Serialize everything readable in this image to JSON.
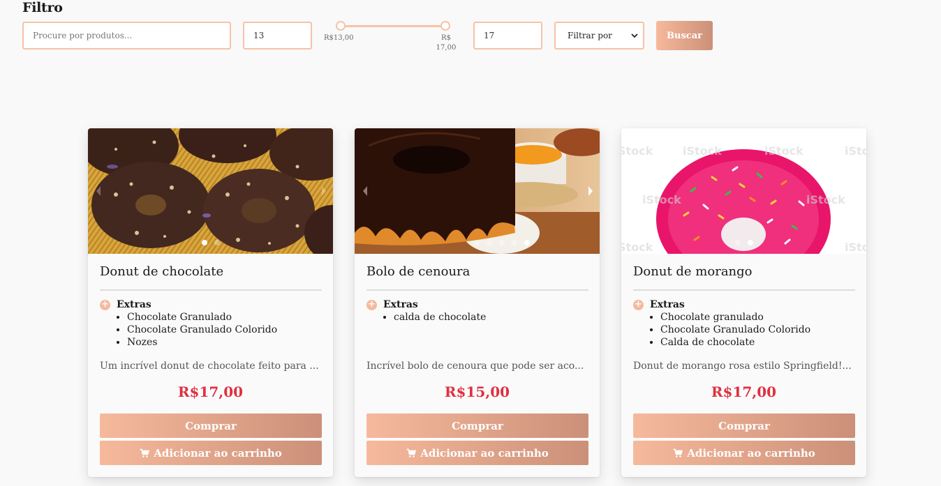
{
  "filter": {
    "title": "Filtro",
    "search_placeholder": "Procure por produtos...",
    "min_value": "13",
    "max_value": "17",
    "range_min_label": "R$13,00",
    "range_max_label": "R$ 17,00",
    "range_min": 13,
    "range_max": 17,
    "sort_selected": "Filtrar por",
    "search_button": "Buscar"
  },
  "colors": {
    "accent": "#f6b99c",
    "accent_dark": "#cb9079",
    "price": "#e03040",
    "border": "#f6c3a7"
  },
  "products": [
    {
      "name": "Donut de chocolate",
      "extras_title": "Extras",
      "extras": [
        "Chocolate Granulado",
        "Chocolate Granulado Colorido",
        "Nozes"
      ],
      "description": "Um incrível donut de chocolate feito para ...",
      "price": "R$17,00",
      "buy_label": "Comprar",
      "cart_label": "Adicionar ao carrinho",
      "images": 2,
      "active_image": 1
    },
    {
      "name": "Bolo de cenoura",
      "extras_title": "Extras",
      "extras": [
        "calda de chocolate"
      ],
      "description": "Incrível bolo de cenoura que pode ser aco...",
      "price": "R$15,00",
      "buy_label": "Comprar",
      "cart_label": "Adicionar ao carrinho",
      "images": 5,
      "active_image": 5
    },
    {
      "name": "Donut de morango",
      "extras_title": "Extras",
      "extras": [
        "Chocolate granulado",
        "Chocolate Granulado Colorido",
        "Calda de chocolate"
      ],
      "description": "Donut de morango rosa estilo Springfield!...",
      "price": "R$17,00",
      "buy_label": "Comprar",
      "cart_label": "Adicionar ao carrinho",
      "images": 2,
      "active_image": 2
    }
  ]
}
